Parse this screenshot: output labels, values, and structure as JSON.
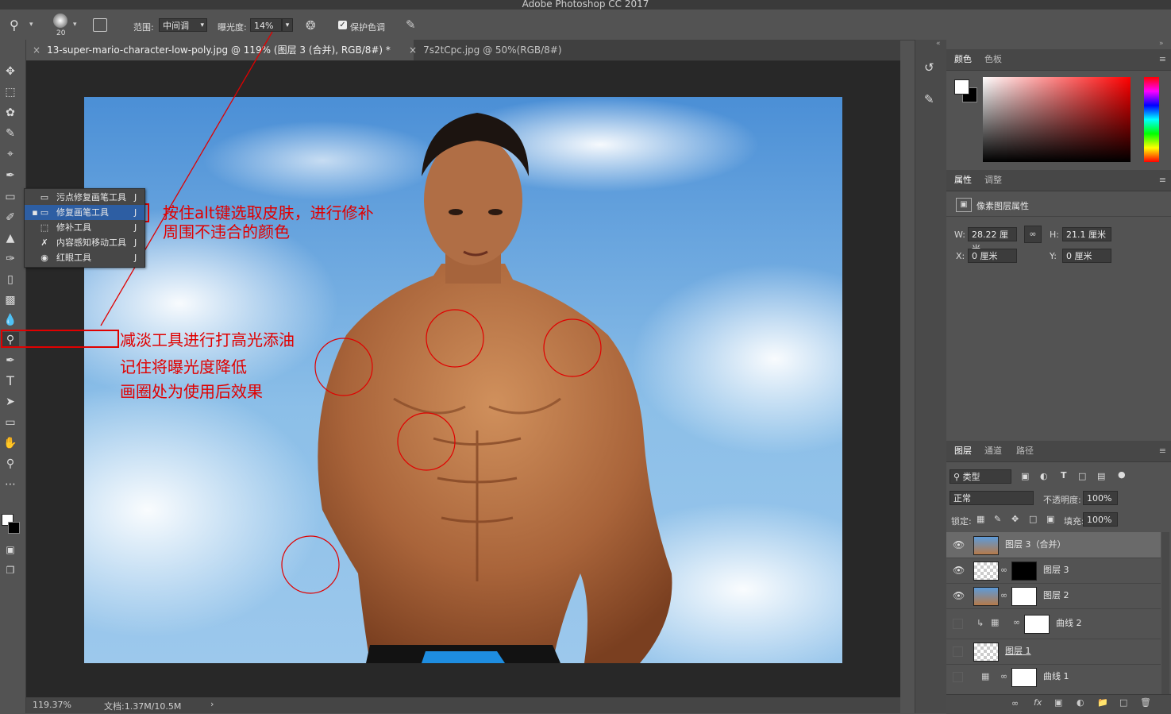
{
  "app": {
    "title": "Adobe Photoshop CC 2017"
  },
  "options": {
    "brush_size": "20",
    "range_label": "范围:",
    "range_value": "中间调",
    "exposure_label": "曝光度:",
    "exposure_value": "14%",
    "protect_tones_label": "保护色调",
    "protect_tones_checked": true
  },
  "tabs": [
    {
      "label": "13-super-mario-character-low-poly.jpg @ 119% (图层 3 (合并), RGB/8#) *",
      "active": true
    },
    {
      "label": "7s2tCpc.jpg @ 50%(RGB/8#)",
      "active": false
    }
  ],
  "flyout": {
    "items": [
      {
        "label": "污点修复画笔工具",
        "key": "J",
        "icon": "spot-healing-icon"
      },
      {
        "label": "修复画笔工具",
        "key": "J",
        "icon": "healing-brush-icon",
        "selected": true
      },
      {
        "label": "修补工具",
        "key": "J",
        "icon": "patch-icon"
      },
      {
        "label": "内容感知移动工具",
        "key": "J",
        "icon": "content-aware-move-icon"
      },
      {
        "label": "红眼工具",
        "key": "J",
        "icon": "red-eye-icon"
      }
    ]
  },
  "annotations": {
    "heal_note": "按住alt键选取皮肤，进行修补周围不违合的颜色",
    "dodge_line1": "减淡工具进行打高光添油",
    "dodge_line2": "记住将曝光度降低",
    "dodge_line3": "画圈处为使用后效果",
    "color": "#e00000"
  },
  "status": {
    "zoom": "119.37%",
    "doc": "文档:1.37M/10.5M"
  },
  "color_panel": {
    "tabs": [
      "颜色",
      "色板"
    ]
  },
  "properties": {
    "tabs": [
      "属性",
      "调整"
    ],
    "heading": "像素图层属性",
    "w_label": "W:",
    "w_value": "28.22 厘米",
    "h_label": "H:",
    "h_value": "21.1 厘米",
    "x_label": "X:",
    "x_value": "0 厘米",
    "y_label": "Y:",
    "y_value": "0 厘米"
  },
  "layers_panel": {
    "tabs": [
      "图层",
      "通道",
      "路径"
    ],
    "filter": "类型",
    "blend": "正常",
    "opacity_label": "不透明度:",
    "opacity": "100%",
    "lock_label": "锁定:",
    "fill_label": "填充:",
    "fill": "100%",
    "layers": [
      {
        "name": "图层 3（合并）",
        "visible": true,
        "selected": true
      },
      {
        "name": "图层 3",
        "visible": true
      },
      {
        "name": "图层 2",
        "visible": true
      },
      {
        "name": "曲线 2",
        "visible": false
      },
      {
        "name": "图层 1",
        "visible": false
      },
      {
        "name": "曲线 1",
        "visible": false
      }
    ]
  }
}
